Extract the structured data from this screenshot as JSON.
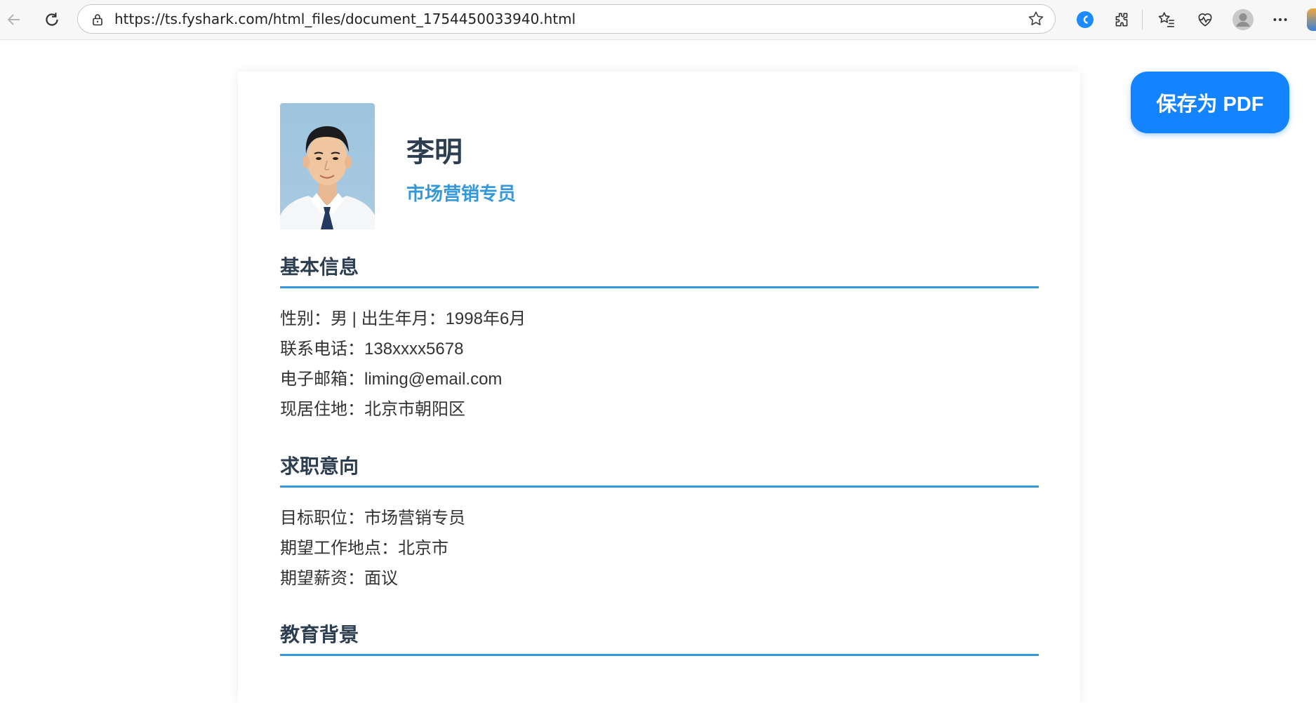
{
  "browser": {
    "url": "https://ts.fyshark.com/html_files/document_1754450033940.html",
    "icons": [
      "back-icon",
      "reload-icon",
      "lock-icon",
      "favorite-star-icon",
      "copilot-icon",
      "extensions-icon",
      "favorites-icon",
      "health-icon",
      "profile-avatar-icon",
      "more-menu-icon"
    ]
  },
  "resume": {
    "name": "李明",
    "title": "市场营销专员",
    "sections": {
      "basic": {
        "heading": "基本信息",
        "lines": [
          "性别：男 | 出生年月：1998年6月",
          "联系电话：138xxxx5678",
          "电子邮箱：liming@email.com",
          "现居住地：北京市朝阳区"
        ]
      },
      "intent": {
        "heading": "求职意向",
        "lines": [
          "目标职位：市场营销专员",
          "期望工作地点：北京市",
          "期望薪资：面议"
        ]
      },
      "education": {
        "heading": "教育背景"
      }
    }
  },
  "actions": {
    "save_pdf_label": "保存为 PDF"
  },
  "colors": {
    "accent": "#3498db",
    "heading": "#2c3e50",
    "button": "#1483ff"
  }
}
